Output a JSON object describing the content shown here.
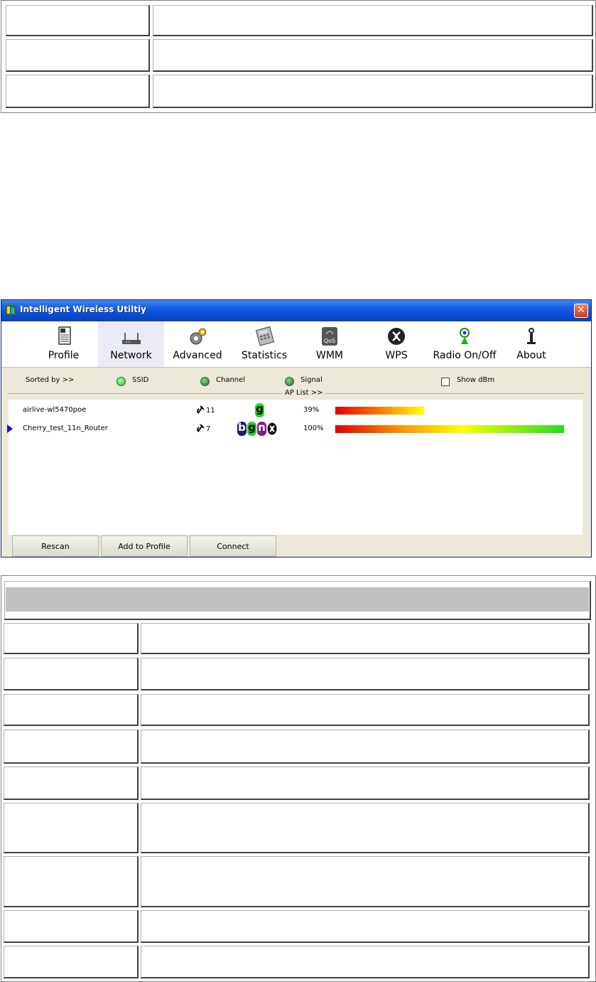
{
  "window": {
    "title": "Intelligent Wireless Utiltiy",
    "close_glyph": "✕"
  },
  "toolbar": {
    "items": [
      {
        "label": "Profile",
        "icon": "profile-icon"
      },
      {
        "label": "Network",
        "icon": "network-icon",
        "active": true
      },
      {
        "label": "Advanced",
        "icon": "advanced-icon"
      },
      {
        "label": "Statistics",
        "icon": "statistics-icon"
      },
      {
        "label": "WMM",
        "icon": "wmm-icon"
      },
      {
        "label": "WPS",
        "icon": "wps-icon"
      },
      {
        "label": "Radio On/Off",
        "icon": "radio-icon"
      },
      {
        "label": "About",
        "icon": "about-icon"
      }
    ]
  },
  "sortbar": {
    "sorted_by": "Sorted by >>",
    "ssid": "SSID",
    "channel": "Channel",
    "signal": "Signal",
    "show_dbm": "Show dBm",
    "ap_list": "AP List >>"
  },
  "ap_list": [
    {
      "ssid": "airlive-wl5470poe",
      "channel": "11",
      "modes": [
        "g"
      ],
      "signal": "39%",
      "signal_value": 39
    },
    {
      "ssid": "Cherry_test_11n_Router",
      "channel": "7",
      "modes": [
        "b",
        "g",
        "n",
        "wps"
      ],
      "signal": "100%",
      "signal_value": 100,
      "selected": true
    }
  ],
  "buttons": {
    "rescan": "Rescan",
    "add_to_profile": "Add to Profile",
    "connect": "Connect"
  },
  "colors": {
    "mode_b": "#1a1a7a",
    "mode_g": "#2ecc2e",
    "mode_n": "#8a1a8a"
  }
}
